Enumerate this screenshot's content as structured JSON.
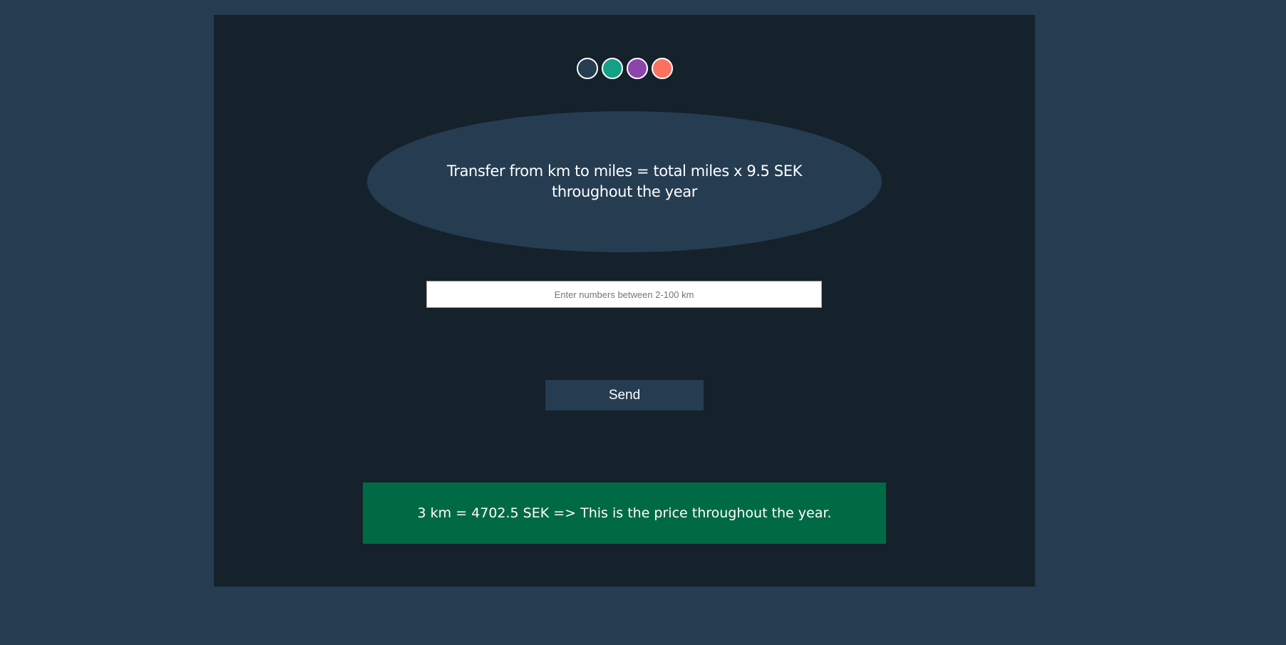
{
  "colors": {
    "page_background": "#253c51",
    "panel_background": "#15212b",
    "ellipse_background": "#253c51",
    "button_background": "#253c51",
    "result_background": "#006a45"
  },
  "theme_swatches": [
    {
      "color": "#253c51",
      "name": "navy"
    },
    {
      "color": "#13a085",
      "name": "teal"
    },
    {
      "color": "#8e44ad",
      "name": "purple"
    },
    {
      "color": "#fd7160",
      "name": "coral"
    }
  ],
  "info": {
    "text": "Transfer from km to miles = total miles x 9.5 SEK throughout the year"
  },
  "input": {
    "value": "",
    "placeholder": "Enter numbers between 2-100 km"
  },
  "send_button": {
    "label": "Send"
  },
  "result": {
    "text": "3 km = 4702.5 SEK => This is the price throughout the year."
  }
}
